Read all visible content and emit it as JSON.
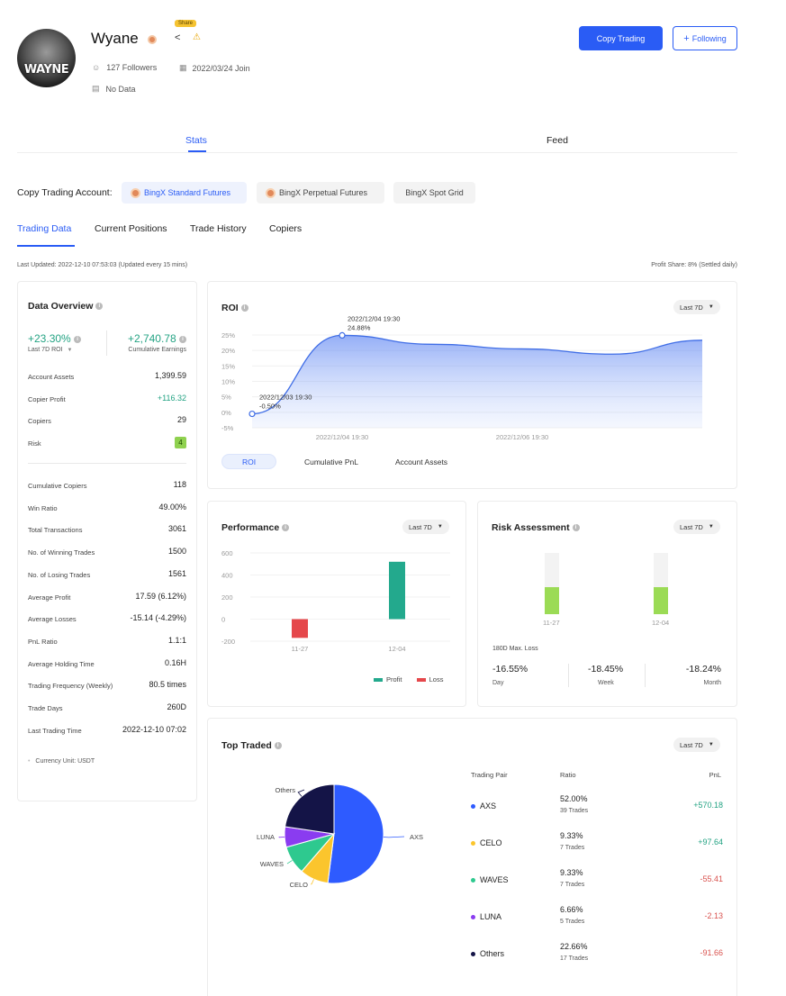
{
  "profile": {
    "name": "Wyane",
    "share_tag": "Share",
    "avatar_text": "WAYNE",
    "followers": "127 Followers",
    "join_date": "2022/03/24 Join",
    "bio": "No Data"
  },
  "header_buttons": {
    "copy_trading": "Copy Trading",
    "following": "Following"
  },
  "main_tabs": [
    "Stats",
    "Feed"
  ],
  "account": {
    "label": "Copy Trading Account:",
    "chips": [
      "BingX Standard Futures",
      "BingX Perpetual Futures",
      "BingX Spot Grid"
    ]
  },
  "sub_tabs": [
    "Trading Data",
    "Current Positions",
    "Trade History",
    "Copiers"
  ],
  "meta": {
    "last_updated": "Last Updated: 2022-12-10 07:53:03 (Updated every 15 mins)",
    "profit_share": "Profit Share: 8% (Settled daily)"
  },
  "overview": {
    "title": "Data Overview",
    "roi_value": "+23.30%",
    "roi_label": "Last 7D ROI",
    "earnings_value": "+2,740.78",
    "earnings_label": "Cumulative Earnings",
    "rows1": [
      {
        "label": "Account Assets",
        "value": "1,399.59"
      },
      {
        "label": "Copier Profit",
        "value": "+116.32"
      },
      {
        "label": "Copiers",
        "value": "29"
      },
      {
        "label": "Risk",
        "value": "4"
      }
    ],
    "rows2": [
      {
        "label": "Cumulative Copiers",
        "value": "118"
      },
      {
        "label": "Win Ratio",
        "value": "49.00%"
      },
      {
        "label": "Total Transactions",
        "value": "3061"
      },
      {
        "label": "No. of Winning Trades",
        "value": "1500"
      },
      {
        "label": "No. of Losing Trades",
        "value": "1561"
      },
      {
        "label": "Average Profit",
        "value": "17.59 (6.12%)"
      },
      {
        "label": "Average Losses",
        "value": "-15.14 (-4.29%)"
      },
      {
        "label": "PnL Ratio",
        "value": "1.1:1"
      },
      {
        "label": "Average Holding Time",
        "value": "0.16H"
      },
      {
        "label": "Trading Frequency (Weekly)",
        "value": "80.5 times"
      },
      {
        "label": "Trade Days",
        "value": "260D"
      },
      {
        "label": "Last Trading Time",
        "value": "2022-12-10 07:02"
      }
    ],
    "currency": "Currency Unit: USDT"
  },
  "roi": {
    "title": "ROI",
    "period": "Last 7D",
    "yticks": [
      "25%",
      "20%",
      "15%",
      "10%",
      "5%",
      "0%",
      "-5%"
    ],
    "xticks": [
      "2022/12/04 19:30",
      "2022/12/06 19:30"
    ],
    "peak_date": "2022/12/04 19:30",
    "peak_value": "24.88%",
    "low_date": "2022/12/03 19:30",
    "low_value": "-0.50%",
    "tabs": [
      "ROI",
      "Cumulative PnL",
      "Account Assets"
    ]
  },
  "performance": {
    "title": "Performance",
    "period": "Last 7D",
    "yticks": [
      "600",
      "400",
      "200",
      "0",
      "-200"
    ],
    "legend_profit": "Profit",
    "legend_loss": "Loss"
  },
  "risk": {
    "title": "Risk Assessment",
    "period": "Last 7D",
    "categories": [
      "11-27",
      "12-04"
    ],
    "max_loss_label": "180D Max. Loss",
    "day_value": "-16.55%",
    "day_label": "Day",
    "week_value": "-18.45%",
    "week_label": "Week",
    "month_value": "-18.24%",
    "month_label": "Month"
  },
  "top_traded": {
    "title": "Top Traded",
    "period": "Last 7D",
    "col_pair": "Trading Pair",
    "col_ratio": "Ratio",
    "col_pnl": "PnL",
    "rows": [
      {
        "pair": "AXS",
        "ratio": "52.00%",
        "trades": "39 Trades",
        "pnl": "+570.18"
      },
      {
        "pair": "CELO",
        "ratio": "9.33%",
        "trades": "7 Trades",
        "pnl": "+97.64"
      },
      {
        "pair": "WAVES",
        "ratio": "9.33%",
        "trades": "7 Trades",
        "pnl": "-55.41"
      },
      {
        "pair": "LUNA",
        "ratio": "6.66%",
        "trades": "5 Trades",
        "pnl": "-2.13"
      },
      {
        "pair": "Others",
        "ratio": "22.66%",
        "trades": "17 Trades",
        "pnl": "-91.66"
      }
    ],
    "pie_labels": [
      "Others",
      "LUNA",
      "WAVES",
      "CELO",
      "AXS"
    ]
  },
  "colors": {
    "accent": "#2a5cf5",
    "profit": "#23a98d",
    "loss": "#e5474b",
    "risk_bar": "#9bdb55",
    "axs": "#2e5bff",
    "celo": "#fbc52d",
    "waves": "#2ec98f",
    "luna": "#8a3cf0",
    "others": "#141447"
  },
  "chart_data": [
    {
      "type": "area",
      "title": "ROI",
      "unit": "%",
      "x": [
        "2022/12/03 19:30",
        "2022/12/04 19:30",
        "2022/12/05 19:30",
        "2022/12/06 19:30",
        "2022/12/07 19:30",
        "2022/12/08 19:30"
      ],
      "points": [
        {
          "x": "2022/12/03 19:30",
          "y": -0.5
        },
        {
          "x": "2022/12/04 19:30",
          "y": 24.88
        },
        {
          "x": "2022/12/05 19:30",
          "y": 22.0
        },
        {
          "x": "2022/12/06 19:30",
          "y": 20.5
        },
        {
          "x": "2022/12/07 19:30",
          "y": 18.8
        },
        {
          "x": "2022/12/08 19:30",
          "y": 23.3
        }
      ],
      "ylim": [
        -5,
        25
      ]
    },
    {
      "type": "bar",
      "title": "Performance",
      "categories": [
        "11-27",
        "12-04"
      ],
      "series": [
        {
          "name": "Profit",
          "values": [
            0,
            520
          ]
        },
        {
          "name": "Loss",
          "values": [
            -170,
            0
          ]
        }
      ],
      "ylim": [
        -200,
        600
      ]
    },
    {
      "type": "pie",
      "title": "Top Traded",
      "labels": [
        "AXS",
        "CELO",
        "WAVES",
        "LUNA",
        "Others"
      ],
      "values": [
        52.0,
        9.33,
        9.33,
        6.66,
        22.66
      ]
    }
  ]
}
